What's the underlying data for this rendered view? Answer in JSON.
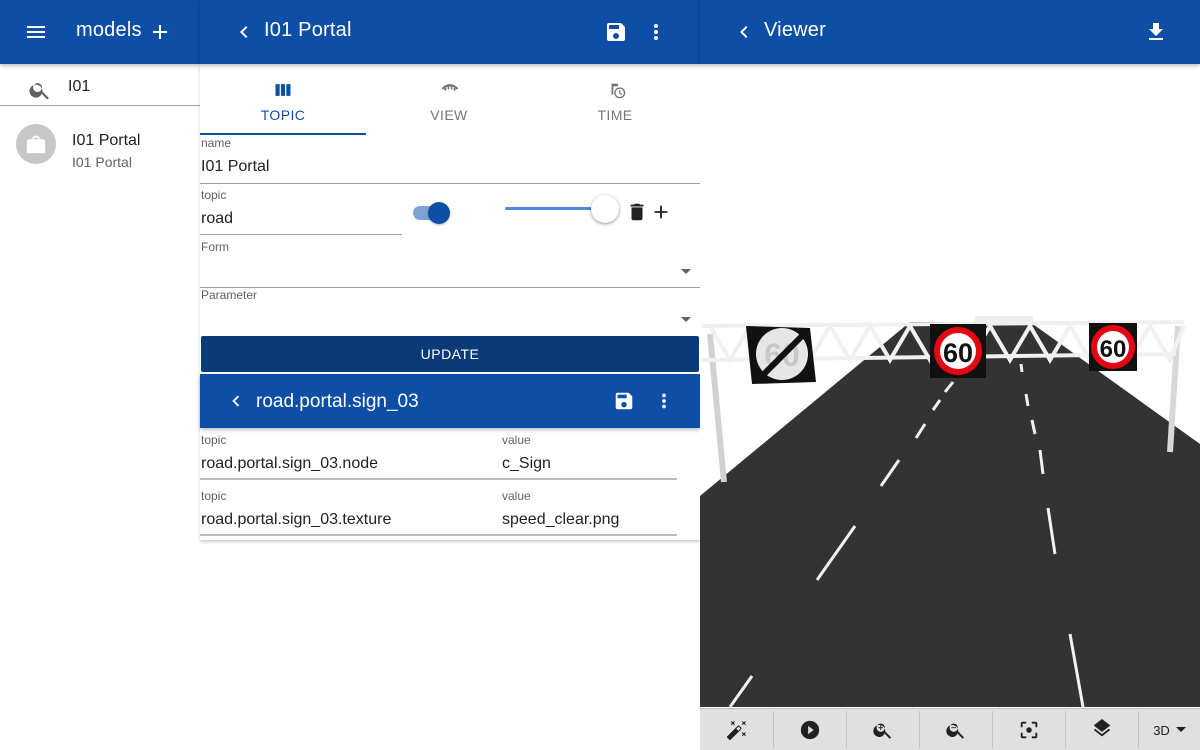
{
  "left": {
    "title": "models",
    "search_value": "I01",
    "items": [
      {
        "title": "I01 Portal",
        "subtitle": "I01 Portal"
      }
    ]
  },
  "middle": {
    "title": "I01 Portal",
    "tabs": [
      {
        "label": "TOPIC",
        "icon": "columns-icon"
      },
      {
        "label": "VIEW",
        "icon": "view-icon"
      },
      {
        "label": "TIME",
        "icon": "time-icon"
      }
    ],
    "fields": {
      "name_label": "name",
      "name_value": "I01 Portal",
      "topic_label": "topic",
      "topic_value": "road",
      "toggle_on": true,
      "slider_value": 1.0,
      "form_label": "Form",
      "form_value": "",
      "parameter_label": "Parameter",
      "parameter_value": ""
    },
    "update_label": "UPDATE",
    "subpanel": {
      "title": "road.portal.sign_03",
      "rows": [
        {
          "topic_label": "topic",
          "topic": "road.portal.sign_03.node",
          "value_label": "value",
          "value": "c_Sign"
        },
        {
          "topic_label": "topic",
          "topic": "road.portal.sign_03.texture",
          "value_label": "value",
          "value": "speed_clear.png"
        }
      ]
    }
  },
  "viewer": {
    "title": "Viewer",
    "signs": [
      "60",
      "60",
      "60"
    ],
    "toolbar": {
      "buttons": [
        "magic-wand-icon",
        "play-icon",
        "zoom-in-icon",
        "zoom-out-icon",
        "center-focus-icon",
        "layers-icon"
      ],
      "mode": "3D"
    }
  },
  "colors": {
    "primary": "#0d4fa6",
    "primary_dark": "#0b3a78",
    "road": "#333333"
  }
}
